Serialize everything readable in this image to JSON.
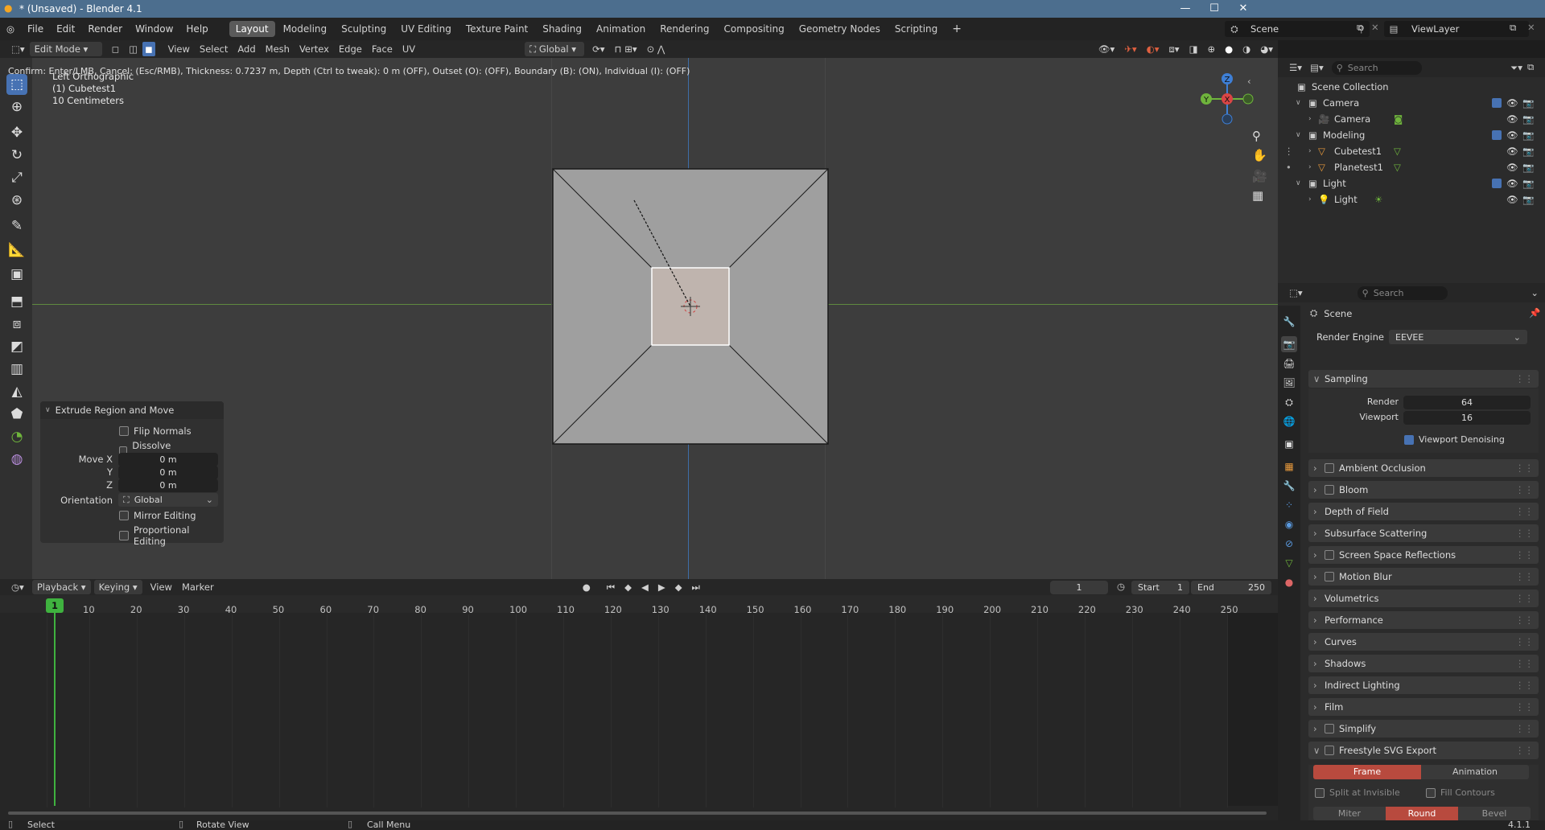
{
  "window": {
    "title": "* (Unsaved) - Blender 4.1",
    "version": "4.1.1"
  },
  "menu": {
    "items": [
      "File",
      "Edit",
      "Render",
      "Window",
      "Help"
    ]
  },
  "workspaces": [
    "Layout",
    "Modeling",
    "Sculpting",
    "UV Editing",
    "Texture Paint",
    "Shading",
    "Animation",
    "Rendering",
    "Compositing",
    "Geometry Nodes",
    "Scripting"
  ],
  "active_workspace": "Layout",
  "scene_selector": {
    "scene": "Scene",
    "view_layer": "ViewLayer"
  },
  "viewport_header": {
    "mode": "Edit Mode",
    "menus": [
      "View",
      "Select",
      "Add",
      "Mesh",
      "Vertex",
      "Edge",
      "Face",
      "UV"
    ],
    "orientation": "Global"
  },
  "status_hint": "Confirm: Enter/LMB, Cancel: (Esc/RMB), Thickness: 0.7237 m, Depth (Ctrl to tweak): 0 m (OFF), Outset (O): (OFF), Boundary (B): (ON), Individual (I): (OFF)",
  "viewport": {
    "view_name": "Left Orthographic",
    "object_name": "(1) Cubetest1",
    "scale_label": "10 Centimeters",
    "gizmo": {
      "z": "Z",
      "y": "Y",
      "x": "X"
    }
  },
  "operator_panel": {
    "title": "Extrude Region and Move",
    "flip_normals": "Flip Normals",
    "dissolve": "Dissolve Orthogonal E...",
    "move_x_label": "Move X",
    "move_x": "0 m",
    "y_label": "Y",
    "y": "0 m",
    "z_label": "Z",
    "z": "0 m",
    "orientation_label": "Orientation",
    "orientation": "Global",
    "mirror": "Mirror Editing",
    "proportional": "Proportional Editing"
  },
  "outliner": {
    "search_placeholder": "Search",
    "root": "Scene Collection",
    "rows": [
      {
        "label": "Camera",
        "type": "collection"
      },
      {
        "label": "Camera",
        "type": "object"
      },
      {
        "label": "Modeling",
        "type": "collection"
      },
      {
        "label": "Cubetest1",
        "type": "object"
      },
      {
        "label": "Planetest1",
        "type": "object"
      },
      {
        "label": "Light",
        "type": "collection"
      },
      {
        "label": "Light",
        "type": "object"
      }
    ]
  },
  "properties": {
    "search_placeholder": "Search",
    "context": "Scene",
    "render_engine_label": "Render Engine",
    "render_engine": "EEVEE",
    "sampling": "Sampling",
    "render_label": "Render",
    "render_value": "64",
    "viewport_label": "Viewport",
    "viewport_value": "16",
    "viewport_denoising": "Viewport Denoising",
    "sections": [
      "Ambient Occlusion",
      "Bloom",
      "Depth of Field",
      "Subsurface Scattering",
      "Screen Space Reflections",
      "Motion Blur",
      "Volumetrics",
      "Performance",
      "Curves",
      "Shadows",
      "Indirect Lighting",
      "Film",
      "Simplify",
      "Freestyle SVG Export"
    ],
    "frame_tab": "Frame",
    "animation_tab": "Animation",
    "split_invisible": "Split at Invisible",
    "fill_contours": "Fill Contours",
    "miter": "Miter",
    "round": "Round",
    "bevel": "Bevel"
  },
  "timeline": {
    "menus": [
      "Playback",
      "Keying",
      "View",
      "Marker"
    ],
    "current_frame": "1",
    "start_label": "Start",
    "start": "1",
    "end_label": "End",
    "end": "250",
    "ticks": [
      "1",
      "10",
      "20",
      "30",
      "40",
      "50",
      "60",
      "70",
      "80",
      "90",
      "100",
      "110",
      "120",
      "130",
      "140",
      "150",
      "160",
      "170",
      "180",
      "190",
      "200",
      "210",
      "220",
      "230",
      "240",
      "250"
    ]
  },
  "statusbar": {
    "select": "Select",
    "rotate": "Rotate View",
    "menu": "Call Menu"
  },
  "colors": {
    "accent": "#4772b3",
    "x_axis": "#d94545",
    "y_axis": "#6fb43c",
    "z_axis": "#3e7fd6",
    "frame_cursor": "#3fb23f"
  }
}
